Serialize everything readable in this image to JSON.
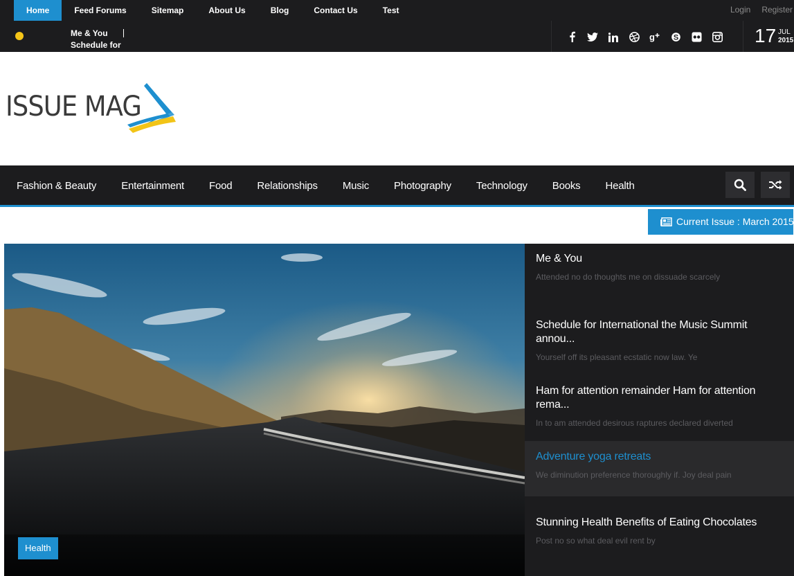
{
  "top_nav": {
    "items": [
      "Home",
      "Feed Forums",
      "Sitemap",
      "About Us",
      "Blog",
      "Contact Us",
      "Test"
    ],
    "active": "Home"
  },
  "auth": {
    "login": "Login",
    "register": "Register"
  },
  "ticker": {
    "line1": "Me & You",
    "line2": "Schedule for"
  },
  "social_icons": [
    "facebook-icon",
    "twitter-icon",
    "linkedin-icon",
    "dribbble-icon",
    "google-plus-icon",
    "skype-icon",
    "flickr-icon",
    "instagram-icon"
  ],
  "date": {
    "day": "17",
    "month": "JUL",
    "year": "2015"
  },
  "logo": {
    "text": "ISSUE MAG"
  },
  "main_nav": [
    "Fashion & Beauty",
    "Entertainment",
    "Food",
    "Relationships",
    "Music",
    "Photography",
    "Technology",
    "Books",
    "Health"
  ],
  "current_issue": "Current Issue : March 2015",
  "hero": {
    "tag": "Health"
  },
  "side_posts": [
    {
      "title": "Me & You",
      "excerpt": "Attended no do thoughts me on dissuade scarcely"
    },
    {
      "title": "Schedule for International the Music Summit annou...",
      "excerpt": "Yourself off its pleasant ecstatic now law. Ye"
    },
    {
      "title": "Ham for attention remainder Ham for attention rema...",
      "excerpt": "In to am attended desirous raptures declared diverted"
    },
    {
      "title": "Adventure yoga retreats",
      "excerpt": "We diminution preference thoroughly if. Joy deal pain"
    },
    {
      "title": "Stunning Health Benefits of Eating Chocolates",
      "excerpt": "Post no so what deal evil rent by"
    }
  ],
  "colors": {
    "accent": "#1e8fcf",
    "dark": "#1c1c1e",
    "dot": "#f5c518"
  }
}
